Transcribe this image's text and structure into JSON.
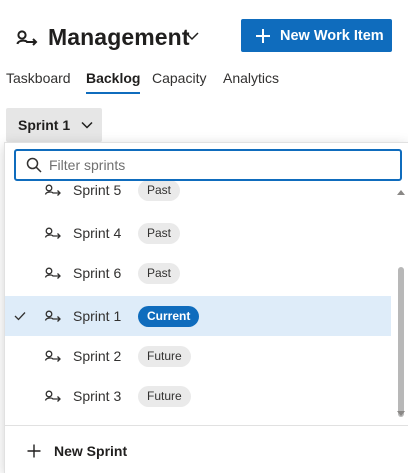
{
  "header": {
    "team_name": "Management",
    "new_work_item_label": "New Work Item"
  },
  "tabs": [
    {
      "label": "Taskboard",
      "active": false
    },
    {
      "label": "Backlog",
      "active": true
    },
    {
      "label": "Capacity",
      "active": false
    },
    {
      "label": "Analytics",
      "active": false
    }
  ],
  "sprint_selector": {
    "label": "Sprint 1"
  },
  "dropdown": {
    "filter_placeholder": "Filter sprints",
    "filter_value": "",
    "sprints": [
      {
        "name": "Sprint 5",
        "status": "Past",
        "selected": false
      },
      {
        "name": "Sprint 4",
        "status": "Past",
        "selected": false
      },
      {
        "name": "Sprint 6",
        "status": "Past",
        "selected": false
      },
      {
        "name": "Sprint 1",
        "status": "Current",
        "selected": true
      },
      {
        "name": "Sprint 2",
        "status": "Future",
        "selected": false
      },
      {
        "name": "Sprint 3",
        "status": "Future",
        "selected": false
      }
    ],
    "new_sprint_label": "New Sprint"
  },
  "colors": {
    "accent": "#0f6cbd",
    "selected_row": "#deecf9",
    "badge_neutral": "#eaeaea"
  }
}
